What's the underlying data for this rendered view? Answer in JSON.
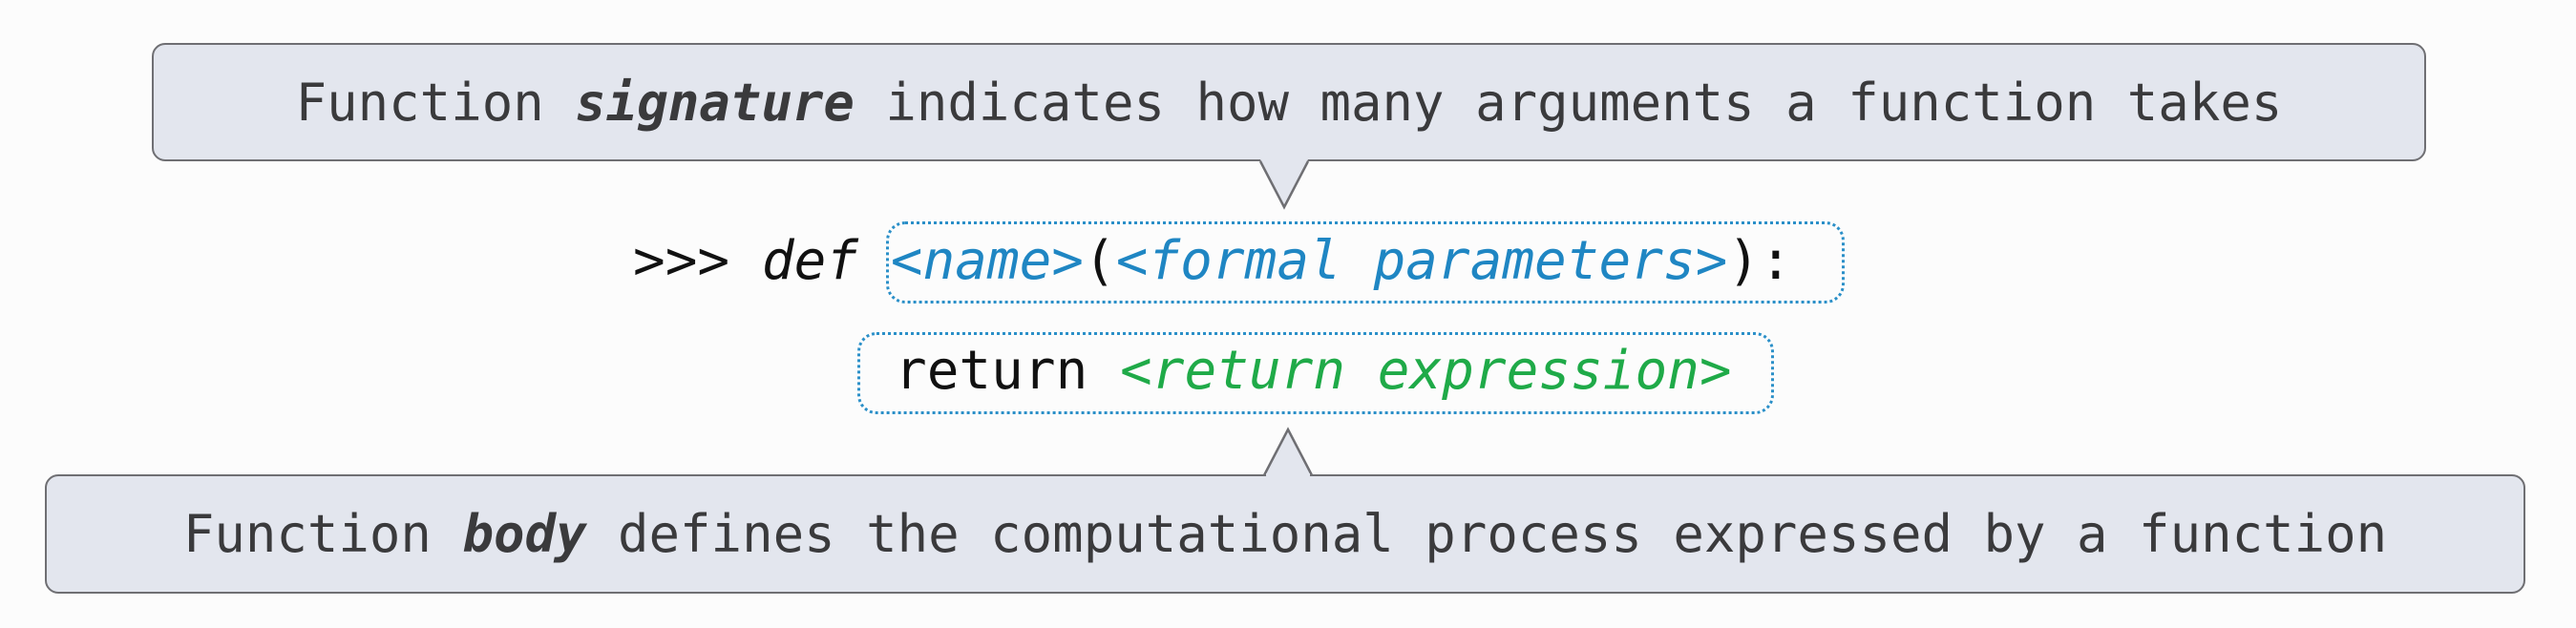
{
  "signature_callout": {
    "prefix": "Function ",
    "keyword": "signature",
    "suffix": " indicates how many arguments a function takes"
  },
  "body_callout": {
    "prefix": "Function ",
    "keyword": "body",
    "suffix": " defines the computational process expressed by a function"
  },
  "code": {
    "prompt": ">>> ",
    "def_keyword": "def",
    "name_placeholder": "<name>",
    "open_paren": "(",
    "params_placeholder": "<formal parameters>",
    "close_colon": "):",
    "return_keyword": "return ",
    "return_placeholder": "<return expression>"
  },
  "colors": {
    "callout_fill": "#e3e6ee",
    "callout_border": "#6f6f73",
    "placeholder_blue": "#1f86c3",
    "placeholder_green": "#1faa48",
    "dashed_border": "#2a8fc8"
  }
}
